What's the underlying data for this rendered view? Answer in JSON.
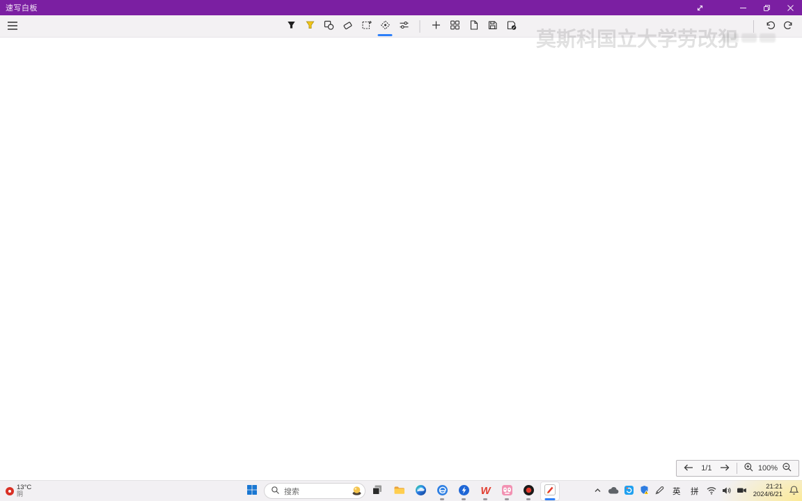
{
  "window": {
    "title": "速写白板",
    "titlebar_color": "#7b1fa2",
    "controls": [
      "fullscreen",
      "minimize",
      "restore",
      "close"
    ]
  },
  "toolbar": {
    "menu_icon": "hamburger-icon",
    "tools": [
      "pen",
      "highlighter",
      "shapes",
      "eraser",
      "select",
      "move",
      "adjust"
    ],
    "active_tool": "move",
    "page_actions": [
      "add",
      "page-grid",
      "new-page",
      "save",
      "save-as"
    ],
    "history": [
      "undo",
      "redo"
    ],
    "accent_color": "#2d7ff9"
  },
  "canvas": {
    "watermark_text": "莫斯科国立大学劳改犯"
  },
  "page_controls": {
    "prev_icon": "arrow-left-icon",
    "page_indicator": "1/1",
    "next_icon": "arrow-right-icon",
    "zoom_in_icon": "zoom-in-icon",
    "zoom_level": "100%",
    "zoom_out_icon": "zoom-out-icon"
  },
  "taskbar": {
    "weather": {
      "temperature": "13°C",
      "condition": "阴"
    },
    "search": {
      "placeholder": "搜索"
    },
    "apps": [
      "start",
      "task-view",
      "file-explorer",
      "edge",
      "e-learning-app",
      "thunder",
      "wps-office",
      "pink-social-app",
      "screen-recorder",
      "sketch-whiteboard"
    ],
    "active_app": "sketch-whiteboard",
    "wps_letter": "W",
    "ime": {
      "english": "英",
      "pinyin": "拼"
    },
    "tray_icons": [
      "chevron-up",
      "onedrive-cloud",
      "sync-app",
      "security-shield",
      "pen",
      "wifi",
      "volume",
      "camera"
    ],
    "clock": {
      "time": "21:21",
      "date": "2024/6/21"
    }
  }
}
